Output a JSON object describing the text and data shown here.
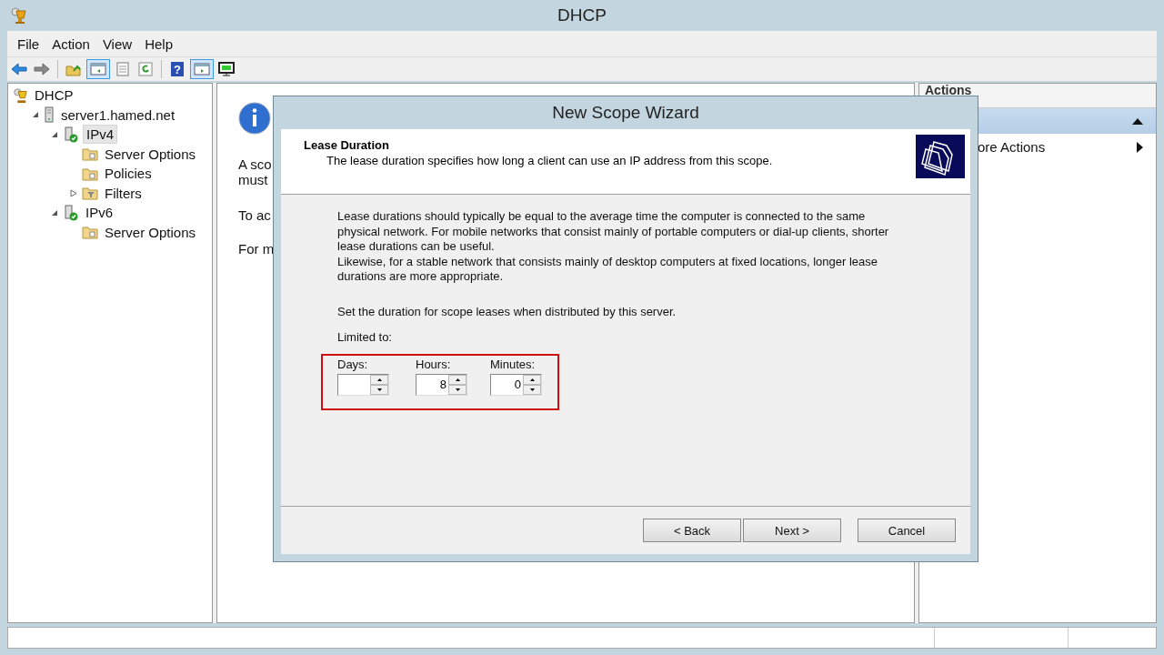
{
  "window": {
    "title": "DHCP"
  },
  "menu": [
    "File",
    "Action",
    "View",
    "Help"
  ],
  "toolbar": [
    {
      "kind": "back",
      "pressed": false
    },
    {
      "kind": "forward",
      "pressed": false
    },
    {
      "kind": "separator"
    },
    {
      "kind": "up",
      "pressed": false
    },
    {
      "kind": "tree",
      "pressed": true
    },
    {
      "kind": "export",
      "pressed": false
    },
    {
      "kind": "refresh",
      "pressed": false
    },
    {
      "kind": "separator"
    },
    {
      "kind": "help",
      "label": "?",
      "pressed": false
    },
    {
      "kind": "actionpane",
      "pressed": true
    },
    {
      "kind": "monitor",
      "pressed": false
    }
  ],
  "tree": [
    {
      "label": "DHCP",
      "kind": "root",
      "selected": false,
      "children": [
        {
          "label": "server1.hamed.net",
          "kind": "server",
          "selected": false,
          "expanded": true,
          "children": [
            {
              "label": "IPv4",
              "kind": "protocol",
              "selected": true,
              "expanded": true,
              "children": [
                {
                  "label": "Server Options",
                  "kind": "folder",
                  "selected": false
                },
                {
                  "label": "Policies",
                  "kind": "folder",
                  "selected": false
                },
                {
                  "label": "Filters",
                  "kind": "filter",
                  "selected": false,
                  "expanded": false
                }
              ]
            },
            {
              "label": "IPv6",
              "kind": "protocol",
              "selected": false,
              "expanded": true,
              "children": [
                {
                  "label": "Server Options",
                  "kind": "folder",
                  "selected": false
                }
              ]
            }
          ]
        }
      ]
    }
  ],
  "middle": {
    "lines": [
      "A sco",
      "must",
      "To ac",
      "For m"
    ]
  },
  "actions": {
    "title": "Actions",
    "items": [
      {
        "label": "ore Actions"
      }
    ]
  },
  "dialog": {
    "title": "New Scope Wizard",
    "heading": "Lease Duration",
    "subheading": "The lease duration specifies how long a client can use an IP address from this scope.",
    "paragraphs": [
      "Lease durations should typically be equal to the average time the computer is connected to the same physical network. For mobile networks that consist mainly of portable computers or dial-up clients, shorter lease durations can be useful.",
      "Likewise, for a stable network that consists mainly of desktop computers at fixed locations, longer lease durations are more appropriate."
    ],
    "prompt": "Set the duration for scope leases when distributed by this server.",
    "limited_label": "Limited to:",
    "spinners": [
      {
        "label": "Days:"
      },
      {
        "label": "Hours:",
        "value": "8"
      },
      {
        "label": "Minutes:",
        "value": "0"
      }
    ],
    "buttons": [
      {
        "label": "< Back"
      },
      {
        "label": "Next >"
      },
      {
        "label": "Cancel"
      }
    ]
  }
}
